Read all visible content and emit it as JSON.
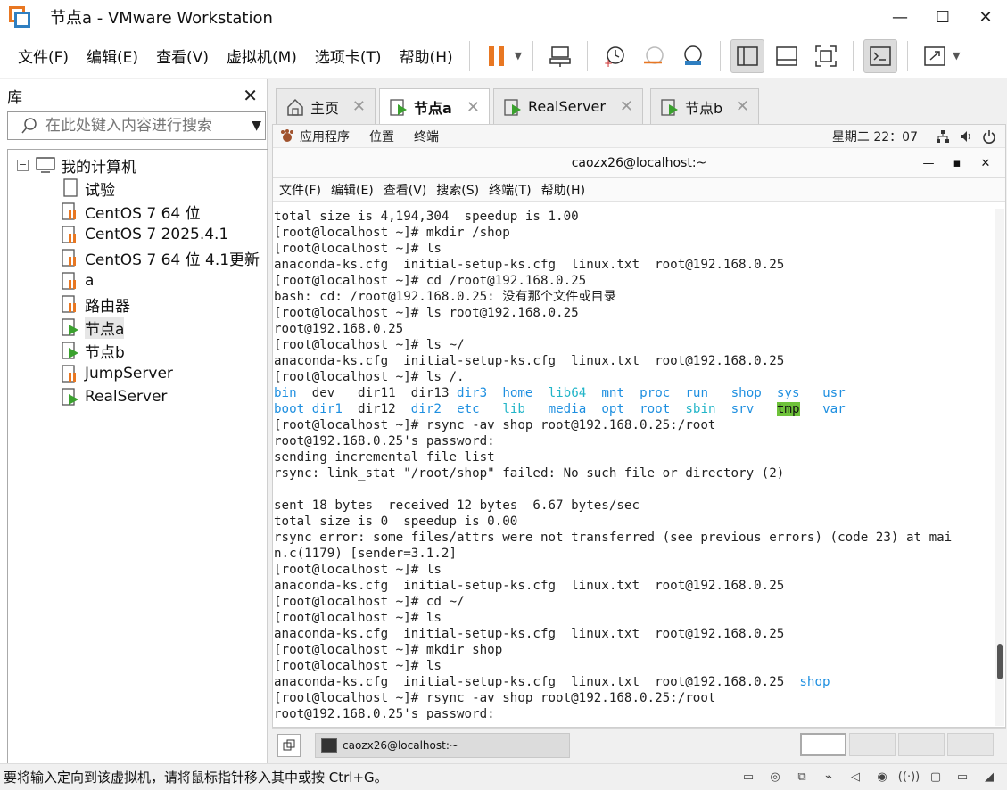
{
  "window": {
    "title": "节点a - VMware Workstation",
    "controls": [
      "—",
      "☐",
      "✕"
    ]
  },
  "menubar": {
    "items": [
      "文件(F)",
      "编辑(E)",
      "查看(V)",
      "虚拟机(M)",
      "选项卡(T)",
      "帮助(H)"
    ]
  },
  "library": {
    "title": "库",
    "search_placeholder": "在此处键入内容进行搜索",
    "root": "我的计算机",
    "items": [
      {
        "label": "试验",
        "icon": "page-icon"
      },
      {
        "label": "CentOS 7 64 位",
        "icon": "vm-stopped-icon"
      },
      {
        "label": "CentOS 7 2025.4.1",
        "icon": "vm-stopped-icon"
      },
      {
        "label": "CentOS 7 64 位 4.1更新",
        "icon": "vm-stopped-icon"
      },
      {
        "label": "a",
        "icon": "vm-stopped-icon"
      },
      {
        "label": "路由器",
        "icon": "vm-stopped-icon"
      },
      {
        "label": "节点a",
        "icon": "vm-running-icon"
      },
      {
        "label": "节点b",
        "icon": "vm-running-icon"
      },
      {
        "label": "JumpServer",
        "icon": "vm-stopped-icon"
      },
      {
        "label": "RealServer",
        "icon": "vm-running-icon"
      }
    ]
  },
  "tabs": [
    {
      "label": "主页",
      "icon": "home-icon"
    },
    {
      "label": "节点a",
      "icon": "vm-running-icon",
      "active": true
    },
    {
      "label": "RealServer",
      "icon": "vm-running-icon"
    },
    {
      "label": "节点b",
      "icon": "vm-running-icon"
    }
  ],
  "guest": {
    "gnome_menus": [
      "应用程序",
      "位置",
      "终端"
    ],
    "clock": "星期二 22：07",
    "terminal_title": "caozx26@localhost:~",
    "terminal_menus": [
      "文件(F)",
      "编辑(E)",
      "查看(V)",
      "搜索(S)",
      "终端(T)",
      "帮助(H)"
    ],
    "terminal_lines": [
      "total size is 4,194,304  speedup is 1.00",
      "[root@localhost ~]# mkdir /shop",
      "[root@localhost ~]# ls",
      "anaconda-ks.cfg  initial-setup-ks.cfg  linux.txt  root@192.168.0.25",
      "[root@localhost ~]# cd /root@192.168.0.25",
      "bash: cd: /root@192.168.0.25: 没有那个文件或目录",
      "[root@localhost ~]# ls root@192.168.0.25",
      "root@192.168.0.25",
      "[root@localhost ~]# ls ~/",
      "anaconda-ks.cfg  initial-setup-ks.cfg  linux.txt  root@192.168.0.25",
      "[root@localhost ~]# ls /.",
      "__DIR1__",
      "__DIR2__",
      "[root@localhost ~]# rsync -av shop root@192.168.0.25:/root",
      "root@192.168.0.25's password:",
      "sending incremental file list",
      "rsync: link_stat \"/root/shop\" failed: No such file or directory (2)",
      "",
      "sent 18 bytes  received 12 bytes  6.67 bytes/sec",
      "total size is 0  speedup is 0.00",
      "rsync error: some files/attrs were not transferred (see previous errors) (code 23) at mai",
      "n.c(1179) [sender=3.1.2]",
      "[root@localhost ~]# ls",
      "anaconda-ks.cfg  initial-setup-ks.cfg  linux.txt  root@192.168.0.25",
      "[root@localhost ~]# cd ~/",
      "[root@localhost ~]# ls",
      "anaconda-ks.cfg  initial-setup-ks.cfg  linux.txt  root@192.168.0.25",
      "[root@localhost ~]# mkdir shop",
      "[root@localhost ~]# ls",
      "__SHOPLINE__",
      "[root@localhost ~]# rsync -av shop root@192.168.0.25:/root",
      "root@192.168.0.25's password:"
    ],
    "dir_row1": [
      "bin",
      "dev",
      "dir11",
      "dir13",
      "dir3",
      "home",
      "lib64",
      "mnt",
      "proc",
      "run",
      "shop",
      "sys",
      "usr"
    ],
    "dir_row2": [
      "boot",
      "dir1",
      "dir12",
      "dir2",
      "etc",
      "lib",
      "media",
      "opt",
      "root",
      "sbin",
      "srv",
      "tmp",
      "var"
    ],
    "shop_line_prefix": "anaconda-ks.cfg  initial-setup-ks.cfg  linux.txt  root@192.168.0.25  ",
    "shop_line_dir": "shop",
    "taskbar_label": "caozx26@localhost:~"
  },
  "statusbar": {
    "text": "要将输入定向到该虚拟机，请将鼠标指针移入其中或按 Ctrl+G。"
  },
  "colors": {
    "accent_orange": "#e87722",
    "accent_blue": "#2f7fc1",
    "dir_blue": "#1e8fe0",
    "dir_cyan": "#22b5c8",
    "tmp_highlight": "#6ec23a",
    "run_green": "#3aa12e"
  }
}
